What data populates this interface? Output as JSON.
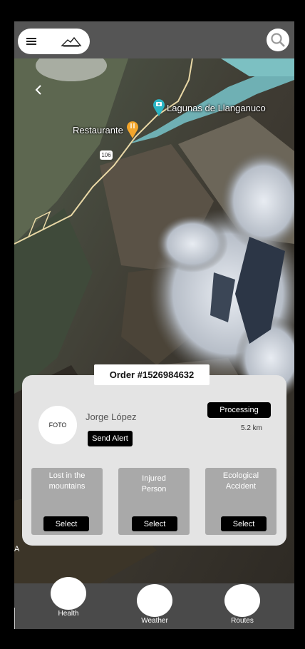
{
  "map": {
    "lake_label": "Lagunas de Llanganuco",
    "restaurant_label": "Restaurante",
    "road_number": "106",
    "edge_text": "A"
  },
  "order": {
    "title": "Order #1526984632",
    "photo_placeholder": "FOTO",
    "person_name": "Jorge López",
    "alert_button": "Send Alert",
    "status": "Processing",
    "distance": "5.2 km"
  },
  "incident_types": [
    {
      "label": "Lost in the mountains",
      "button": "Select"
    },
    {
      "label": "Injured Person",
      "button": "Select"
    },
    {
      "label": "Ecological Accident",
      "button": "Select"
    }
  ],
  "bottom_nav": [
    {
      "label": "Health"
    },
    {
      "label": "Weather"
    },
    {
      "label": "Routes"
    }
  ],
  "colors": {
    "lake": "#6fb0b4",
    "pin_orange": "#f2a52b",
    "pin_teal": "#2bb5c4",
    "road": "#e9d8a6"
  },
  "icons": [
    "hamburger-menu-icon",
    "mountain-logo-icon",
    "search-icon",
    "back-arrow-icon",
    "camera-pin-icon",
    "food-pin-icon"
  ]
}
